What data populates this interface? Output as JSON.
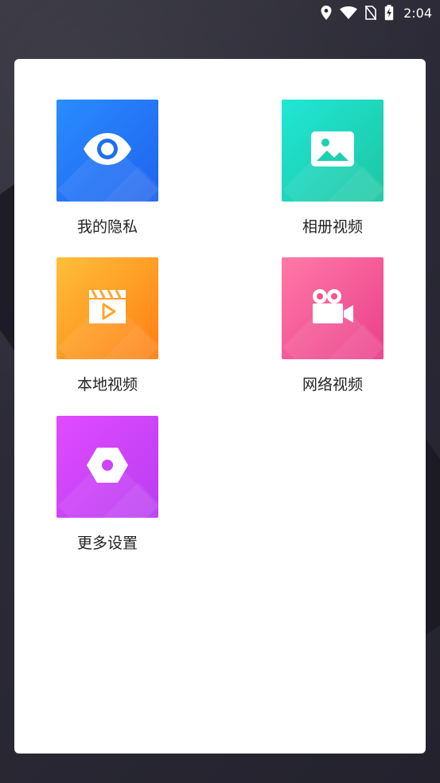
{
  "status_bar": {
    "time": "2:04",
    "icons": [
      "location-icon",
      "wifi-icon",
      "no-sim-icon",
      "battery-charging-icon"
    ]
  },
  "tiles": [
    {
      "label": "我的隐私",
      "icon": "eye-icon",
      "color": "#1f63ee"
    },
    {
      "label": "相册视频",
      "icon": "image-icon",
      "color": "#1cc6a1"
    },
    {
      "label": "本地视频",
      "icon": "video-clip-icon",
      "color": "#ff7e12"
    },
    {
      "label": "网络视频",
      "icon": "video-camera-icon",
      "color": "#ea3e8b"
    },
    {
      "label": "更多设置",
      "icon": "settings-hex-icon",
      "color": "#b93df2"
    }
  ]
}
